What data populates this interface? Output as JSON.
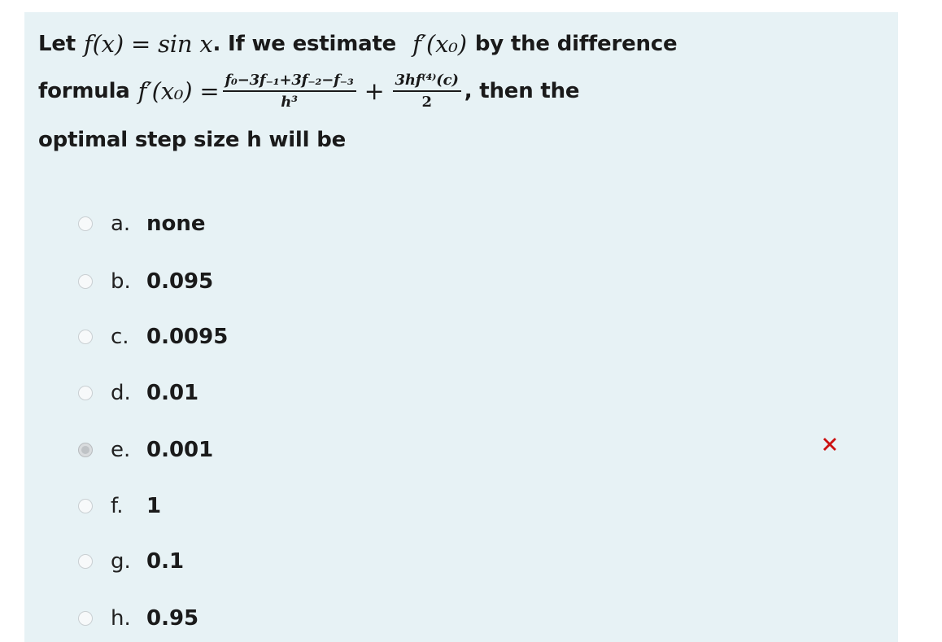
{
  "question": {
    "line1_prefix": "Let",
    "line1_mid": ". If we estimate",
    "line1_suffix": "by the difference",
    "f_of_x": "f(x) = sin x",
    "fprime_x0": "f′(x₀)",
    "line2_prefix": "formula",
    "fprime_x0_eq": "f′(x₀) =",
    "frac1_num": "f₀−3f₋₁+3f₋₂−f₋₃",
    "frac1_den": "h³",
    "plus": "+",
    "frac2_num": "3hf⁽⁴⁾(c)",
    "frac2_den": "2",
    "line2_suffix": ", then the",
    "line3": "optimal step size h will be"
  },
  "options": [
    {
      "letter": "a.",
      "text": "none",
      "selected": false
    },
    {
      "letter": "b.",
      "text": "0.095",
      "selected": false
    },
    {
      "letter": "c.",
      "text": "0.0095",
      "selected": false
    },
    {
      "letter": "d.",
      "text": "0.01",
      "selected": false
    },
    {
      "letter": "e.",
      "text": "0.001",
      "selected": true
    },
    {
      "letter": "f.",
      "text": "1",
      "selected": false
    },
    {
      "letter": "g.",
      "text": "0.1",
      "selected": false
    },
    {
      "letter": "h.",
      "text": "0.95",
      "selected": false
    }
  ],
  "feedback": {
    "icon": "cross-icon",
    "color": "#cc1111"
  },
  "colors": {
    "panel_background": "#e7f2f5"
  }
}
